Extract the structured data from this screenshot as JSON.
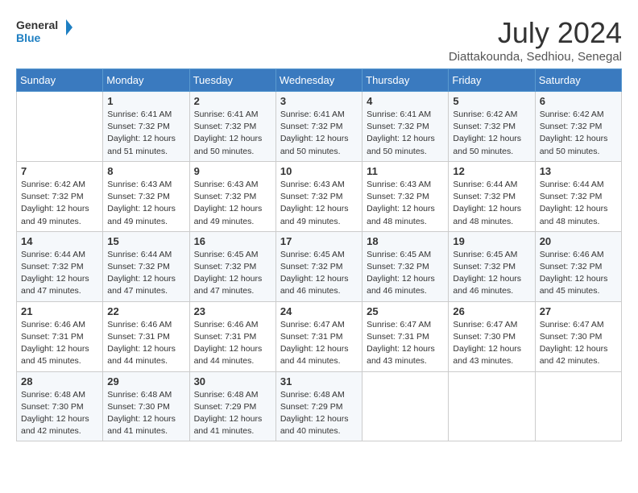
{
  "header": {
    "logo_line1": "General",
    "logo_line2": "Blue",
    "title": "July 2024",
    "location": "Diattakounda, Sedhiou, Senegal"
  },
  "weekdays": [
    "Sunday",
    "Monday",
    "Tuesday",
    "Wednesday",
    "Thursday",
    "Friday",
    "Saturday"
  ],
  "weeks": [
    [
      {
        "day": null
      },
      {
        "day": 1,
        "sunrise": "6:41 AM",
        "sunset": "7:32 PM",
        "daylight": "12 hours and 51 minutes."
      },
      {
        "day": 2,
        "sunrise": "6:41 AM",
        "sunset": "7:32 PM",
        "daylight": "12 hours and 50 minutes."
      },
      {
        "day": 3,
        "sunrise": "6:41 AM",
        "sunset": "7:32 PM",
        "daylight": "12 hours and 50 minutes."
      },
      {
        "day": 4,
        "sunrise": "6:41 AM",
        "sunset": "7:32 PM",
        "daylight": "12 hours and 50 minutes."
      },
      {
        "day": 5,
        "sunrise": "6:42 AM",
        "sunset": "7:32 PM",
        "daylight": "12 hours and 50 minutes."
      },
      {
        "day": 6,
        "sunrise": "6:42 AM",
        "sunset": "7:32 PM",
        "daylight": "12 hours and 50 minutes."
      }
    ],
    [
      {
        "day": 7,
        "sunrise": "6:42 AM",
        "sunset": "7:32 PM",
        "daylight": "12 hours and 49 minutes."
      },
      {
        "day": 8,
        "sunrise": "6:43 AM",
        "sunset": "7:32 PM",
        "daylight": "12 hours and 49 minutes."
      },
      {
        "day": 9,
        "sunrise": "6:43 AM",
        "sunset": "7:32 PM",
        "daylight": "12 hours and 49 minutes."
      },
      {
        "day": 10,
        "sunrise": "6:43 AM",
        "sunset": "7:32 PM",
        "daylight": "12 hours and 49 minutes."
      },
      {
        "day": 11,
        "sunrise": "6:43 AM",
        "sunset": "7:32 PM",
        "daylight": "12 hours and 48 minutes."
      },
      {
        "day": 12,
        "sunrise": "6:44 AM",
        "sunset": "7:32 PM",
        "daylight": "12 hours and 48 minutes."
      },
      {
        "day": 13,
        "sunrise": "6:44 AM",
        "sunset": "7:32 PM",
        "daylight": "12 hours and 48 minutes."
      }
    ],
    [
      {
        "day": 14,
        "sunrise": "6:44 AM",
        "sunset": "7:32 PM",
        "daylight": "12 hours and 47 minutes."
      },
      {
        "day": 15,
        "sunrise": "6:44 AM",
        "sunset": "7:32 PM",
        "daylight": "12 hours and 47 minutes."
      },
      {
        "day": 16,
        "sunrise": "6:45 AM",
        "sunset": "7:32 PM",
        "daylight": "12 hours and 47 minutes."
      },
      {
        "day": 17,
        "sunrise": "6:45 AM",
        "sunset": "7:32 PM",
        "daylight": "12 hours and 46 minutes."
      },
      {
        "day": 18,
        "sunrise": "6:45 AM",
        "sunset": "7:32 PM",
        "daylight": "12 hours and 46 minutes."
      },
      {
        "day": 19,
        "sunrise": "6:45 AM",
        "sunset": "7:32 PM",
        "daylight": "12 hours and 46 minutes."
      },
      {
        "day": 20,
        "sunrise": "6:46 AM",
        "sunset": "7:32 PM",
        "daylight": "12 hours and 45 minutes."
      }
    ],
    [
      {
        "day": 21,
        "sunrise": "6:46 AM",
        "sunset": "7:31 PM",
        "daylight": "12 hours and 45 minutes."
      },
      {
        "day": 22,
        "sunrise": "6:46 AM",
        "sunset": "7:31 PM",
        "daylight": "12 hours and 44 minutes."
      },
      {
        "day": 23,
        "sunrise": "6:46 AM",
        "sunset": "7:31 PM",
        "daylight": "12 hours and 44 minutes."
      },
      {
        "day": 24,
        "sunrise": "6:47 AM",
        "sunset": "7:31 PM",
        "daylight": "12 hours and 44 minutes."
      },
      {
        "day": 25,
        "sunrise": "6:47 AM",
        "sunset": "7:31 PM",
        "daylight": "12 hours and 43 minutes."
      },
      {
        "day": 26,
        "sunrise": "6:47 AM",
        "sunset": "7:30 PM",
        "daylight": "12 hours and 43 minutes."
      },
      {
        "day": 27,
        "sunrise": "6:47 AM",
        "sunset": "7:30 PM",
        "daylight": "12 hours and 42 minutes."
      }
    ],
    [
      {
        "day": 28,
        "sunrise": "6:48 AM",
        "sunset": "7:30 PM",
        "daylight": "12 hours and 42 minutes."
      },
      {
        "day": 29,
        "sunrise": "6:48 AM",
        "sunset": "7:30 PM",
        "daylight": "12 hours and 41 minutes."
      },
      {
        "day": 30,
        "sunrise": "6:48 AM",
        "sunset": "7:29 PM",
        "daylight": "12 hours and 41 minutes."
      },
      {
        "day": 31,
        "sunrise": "6:48 AM",
        "sunset": "7:29 PM",
        "daylight": "12 hours and 40 minutes."
      },
      {
        "day": null
      },
      {
        "day": null
      },
      {
        "day": null
      }
    ]
  ]
}
